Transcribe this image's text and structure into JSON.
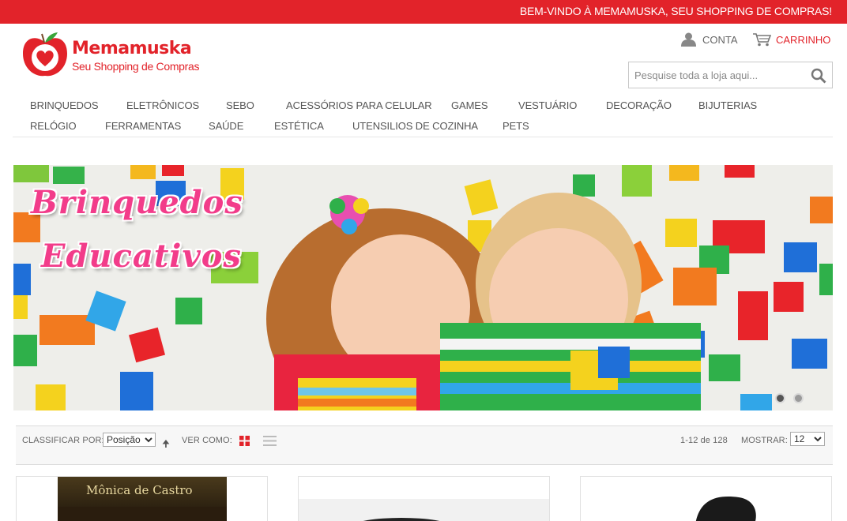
{
  "topbar": {
    "welcome": "BEM-VINDO À MEMAMUSKA, SEU SHOPPING DE COMPRAS!"
  },
  "brand": {
    "name": "Memamuska",
    "tagline": "Seu Shopping de Compras"
  },
  "header": {
    "account_label": "CONTA",
    "cart_label": "CARRINHO",
    "search_placeholder": "Pesquise toda a loja aqui..."
  },
  "nav": {
    "row1": [
      "BRINQUEDOS",
      "ELETRÔNICOS",
      "SEBO",
      "ACESSÓRIOS PARA CELULAR",
      "GAMES",
      "VESTUÁRIO",
      "DECORAÇÃO",
      "BIJUTERIAS"
    ],
    "row2": [
      "RELÓGIO",
      "FERRAMENTAS",
      "SAÚDE",
      "ESTÉTICA",
      "UTENSILIOS DE COZINHA",
      "PETS"
    ]
  },
  "banner": {
    "line1": "Brinquedos",
    "line2": "Educativos",
    "slides": 2,
    "active_slide": 1
  },
  "toolbar": {
    "sort_label": "CLASSIFICAR POR:",
    "sort_value": "Posição",
    "view_label": "VER COMO:",
    "count_text": "1-12 de 128",
    "show_label": "MOSTRAR:",
    "show_value": "12"
  },
  "products": [
    {
      "cover_text": "Mônica de Castro"
    }
  ],
  "colors": {
    "brand_red": "#e2232a",
    "title_pink": "#f23c8a"
  }
}
